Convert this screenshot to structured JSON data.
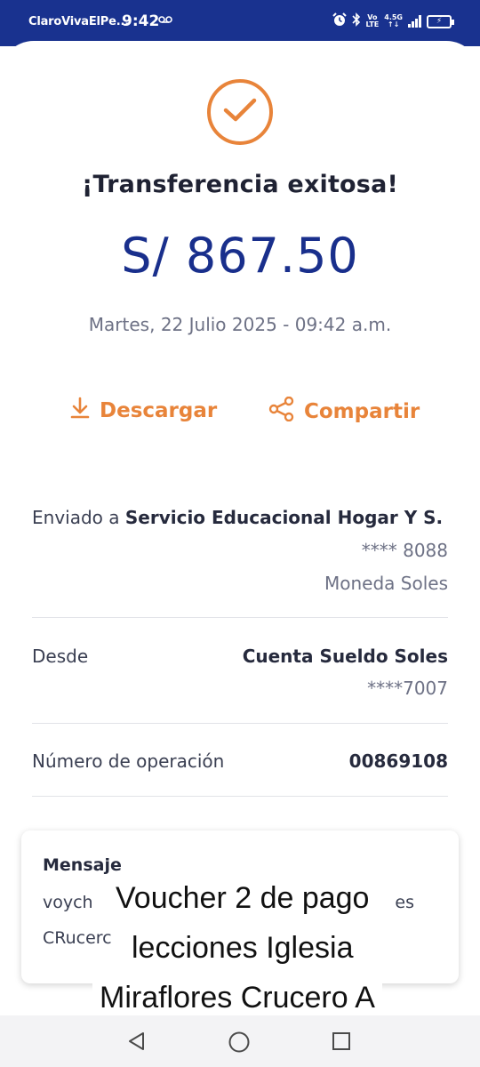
{
  "status_bar": {
    "carrier": "ClaroVivaElPe...",
    "time": "9:42",
    "vm_icon": "voicemail-icon",
    "net_label_top": "Vo",
    "net_label_bottom": "LTE",
    "net_gen_top": "4.5G",
    "net_gen_bottom": "↑↓",
    "battery_level": "charging"
  },
  "colors": {
    "header": "#19328f",
    "accent": "#e8843a",
    "amount": "#192f8c"
  },
  "result": {
    "icon": "check-circle-icon",
    "title": "¡Transferencia exitosa!",
    "amount": "S/ 867.50",
    "datetime": "Martes, 22 Julio 2025 - 09:42 a.m."
  },
  "actions": {
    "download_label": "Descargar",
    "share_label": "Compartir"
  },
  "details": {
    "sent_to_label": "Enviado a",
    "sent_to_name": "Servicio Educacional Hogar Y S.",
    "sent_to_account": "**** 8088",
    "sent_to_currency": "Moneda Soles",
    "from_label": "Desde",
    "from_account_name": "Cuenta Sueldo Soles",
    "from_account_number": "****7007",
    "operation_label": "Número de operación",
    "operation_number": "00869108"
  },
  "message": {
    "title": "Mensaje",
    "line1_start": "voych",
    "line1_end": "es",
    "line2_start": "CRucerc"
  },
  "caption": {
    "line1": "Voucher 2 de pago",
    "line2": "lecciones Iglesia",
    "line3": "Miraflores Crucero A"
  },
  "nav": {
    "back": "back-icon",
    "home": "home-icon",
    "recents": "recents-icon"
  }
}
